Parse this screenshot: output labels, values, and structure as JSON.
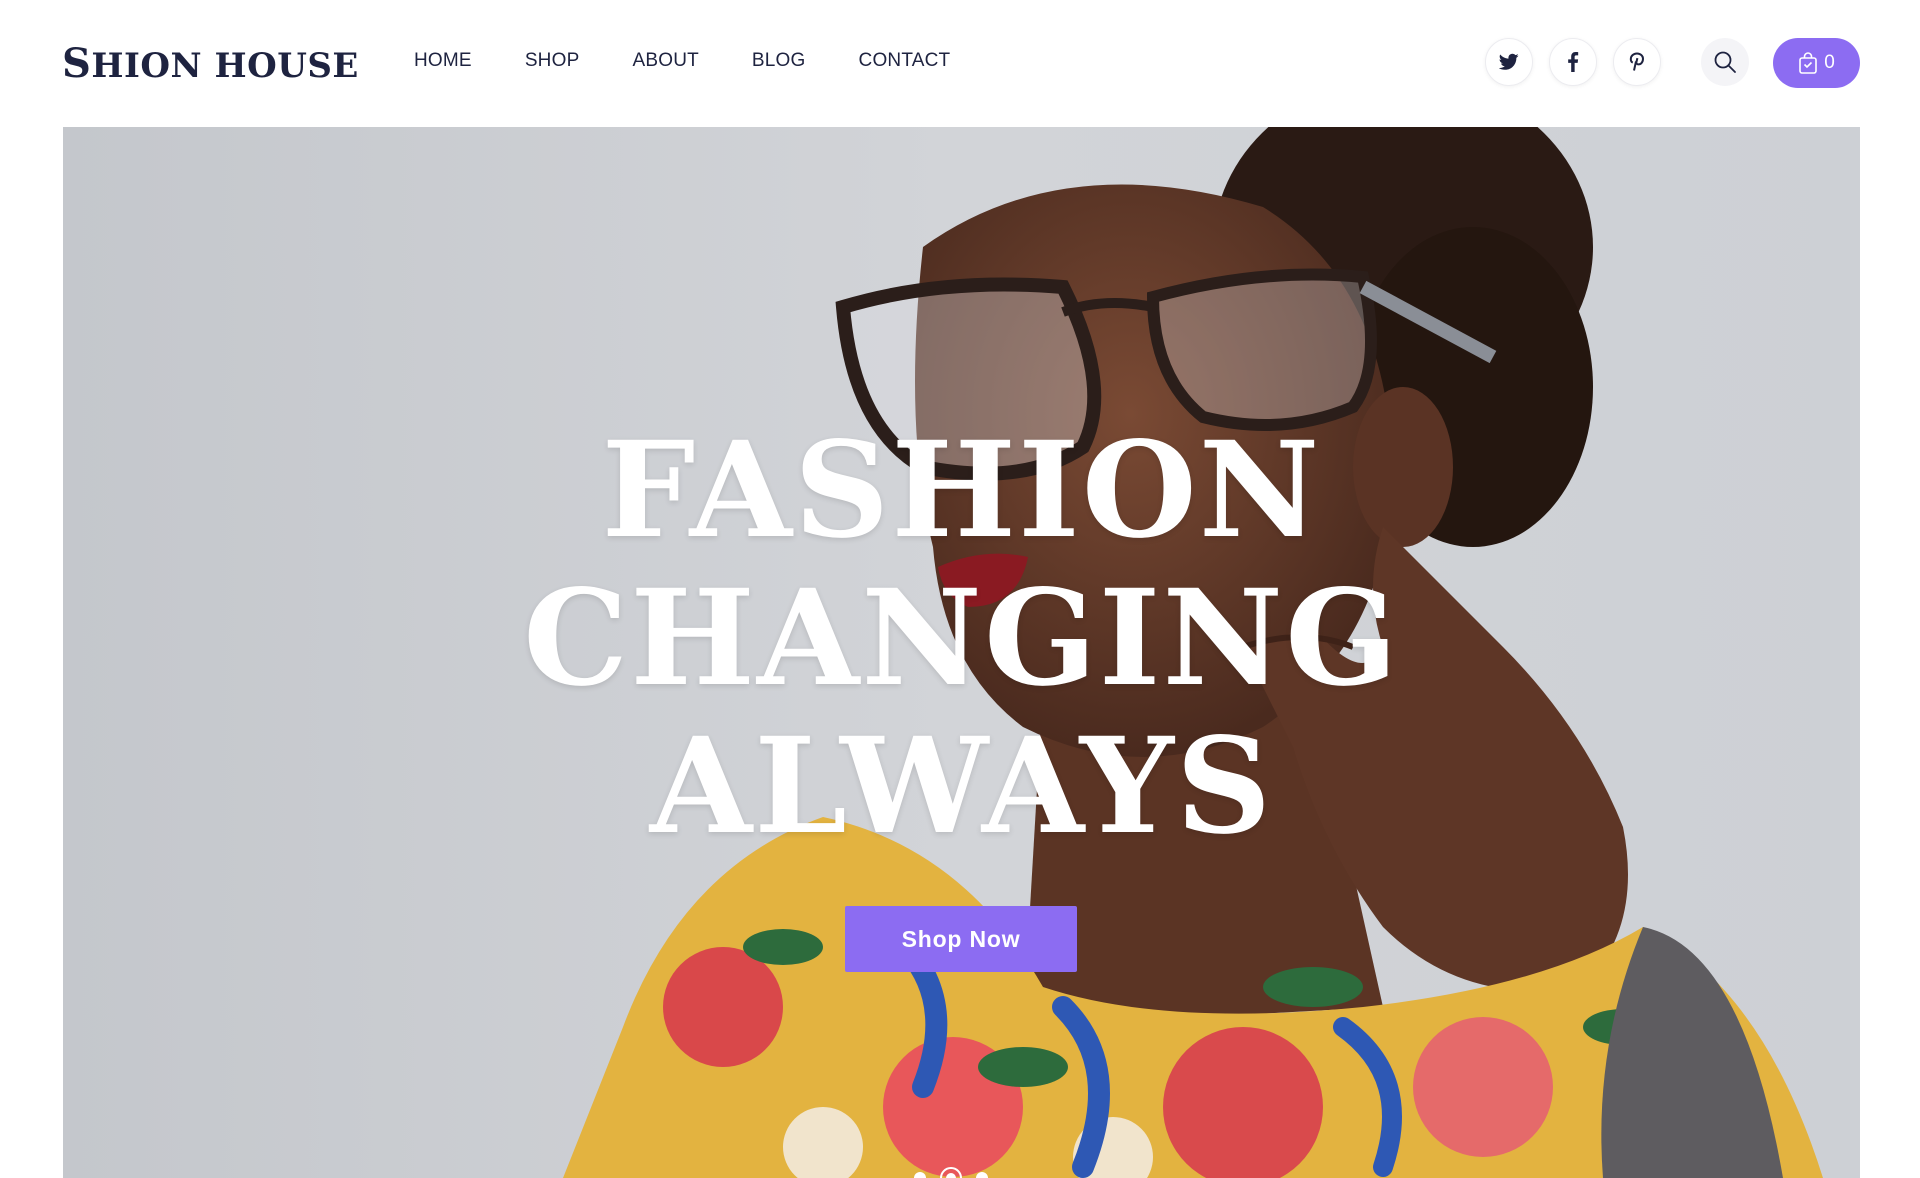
{
  "brand": {
    "logo_first": "S",
    "logo_rest": "HION HOUSE"
  },
  "nav": {
    "items": [
      "HOME",
      "SHOP",
      "ABOUT",
      "BLOG",
      "CONTACT"
    ]
  },
  "social": [
    {
      "icon": "twitter-icon"
    },
    {
      "icon": "facebook-icon"
    },
    {
      "icon": "pinterest-icon"
    }
  ],
  "cart": {
    "count": "0"
  },
  "hero": {
    "lines": [
      "FASHION",
      "CHANGING",
      "ALWAYS"
    ],
    "button_label": "Shop Now",
    "slides": 3,
    "active_slide": 2
  },
  "colors": {
    "accent": "#8c6cf2",
    "text_dark": "#1e2340",
    "hero_bg": "#c9cbd0"
  }
}
